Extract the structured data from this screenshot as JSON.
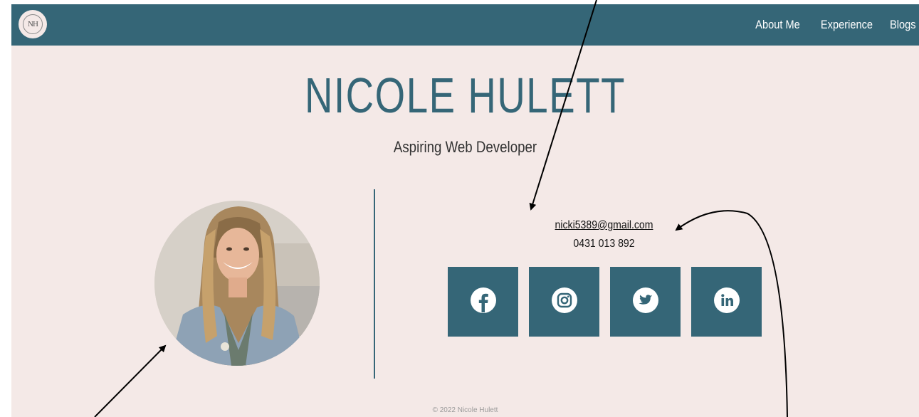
{
  "nav": {
    "logo_text": "NH",
    "links": [
      "About Me",
      "Experience",
      "Blogs"
    ]
  },
  "hero": {
    "name": "NICOLE HULETT",
    "tagline": "Aspiring Web Developer"
  },
  "contact": {
    "email": "nicki5389@gmail.com",
    "phone": "0431 013 892"
  },
  "socials": [
    {
      "name": "facebook-icon"
    },
    {
      "name": "instagram-icon"
    },
    {
      "name": "twitter-icon"
    },
    {
      "name": "linkedin-icon"
    }
  ],
  "footer": {
    "copyright": "© 2022 Nicole Hulett"
  },
  "colors": {
    "brand": "#356677",
    "background": "#f4e9e7",
    "text": "#111111"
  }
}
